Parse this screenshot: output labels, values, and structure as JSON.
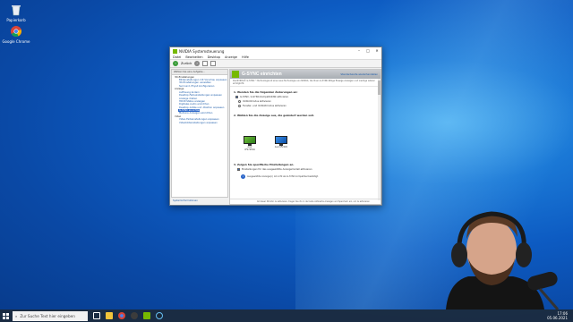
{
  "desktop": {
    "icons": [
      {
        "label": "Papierkorb",
        "icon": "recycle-bin-icon"
      },
      {
        "label": "Google Chrome",
        "icon": "chrome-icon"
      }
    ]
  },
  "window": {
    "title": "NVIDIA Systemsteuerung",
    "menu": [
      "Datei",
      "Bearbeiten",
      "Desktop",
      "Anzeige",
      "Hilfe"
    ],
    "toolbar": {
      "back_label": "Zurück",
      "icons": [
        "back-icon",
        "forward-icon",
        "home-icon",
        "settings-icon"
      ]
    },
    "left_panel": {
      "header": "Wählen Sie eine Aufgabe...",
      "tree": [
        {
          "type": "cat",
          "label": "3D-Einstellungen"
        },
        {
          "type": "item",
          "label": "Bildeinstellungen mit Vorschau anpassen"
        },
        {
          "type": "item",
          "label": "3D-Einstellungen verwalten"
        },
        {
          "type": "item",
          "label": "Surround, PhysX konfigurieren"
        },
        {
          "type": "cat",
          "label": "Anzeige"
        },
        {
          "type": "item",
          "label": "Auflösung ändern"
        },
        {
          "type": "item",
          "label": "Desktop-Farbeinstellungen anpassen"
        },
        {
          "type": "item",
          "label": "Anzeige drehen"
        },
        {
          "type": "item",
          "label": "HDCP-Status anzeigen"
        },
        {
          "type": "item",
          "label": "Digitales Audio einrichten"
        },
        {
          "type": "item",
          "label": "Desktop-Größe und -Position anpassen"
        },
        {
          "type": "item",
          "label": "G-SYNC einrichten",
          "selected": true
        },
        {
          "type": "item",
          "label": "Mehrere Anzeigen einrichten"
        },
        {
          "type": "cat",
          "label": "Video"
        },
        {
          "type": "item",
          "label": "Video-Farbeinstellungen anpassen"
        },
        {
          "type": "item",
          "label": "Videobildeinstellungen anpassen"
        }
      ],
      "status_link": "Systeminformationen"
    },
    "content": {
      "title": "G-SYNC einrichten",
      "restore": "Standardwerte wiederherstellen",
      "description": "Die NVIDIA® G-SYNC™-Technologie ist eine neue Technologie von NVIDIA, die Ihnen G-SYNC-fähige flüssige Anzeigen und niedrige Latenz ermöglicht.",
      "section1": "1. Wenden Sie die folgenden Änderungen an:",
      "enable_gsync": "G-SYNC, G-SYNC-Kompatibilität aktivieren",
      "radio_fullscreen": "Vollbildmodus aktivieren",
      "radio_windowed": "Fenster- und Vollbildmodus aktivieren",
      "section2": "2. Wählen Sie die Anzeige aus, die geändert werden soll.",
      "monitors": [
        {
          "label": "Acer XF270HUA",
          "selected": true
        },
        {
          "label": "Acer KF242Q"
        }
      ],
      "section3": "3. Zeigen Sie spezifische Einstellungen an.",
      "specific_settings": "Einstellungen für das ausgewählte Anzeigemodell aktivieren",
      "info_text": "Ausgewählte Anzeige(n) ist nicht als G-SYNC kompatibel bestätigt.",
      "footer": "Ist dieser Monitor zu aktivieren, tragen Sie ihn in der Liste Aktivierte Anzeigen und Speichern ein, um zu aktivieren"
    }
  },
  "taskbar": {
    "search_placeholder": "Zur Suche Text hier eingeben",
    "apps": [
      "task-view-icon",
      "file-explorer-icon",
      "chrome-icon",
      "obs-icon",
      "nvidia-icon",
      "steam-icon"
    ],
    "time": "17:06",
    "date": "05.06.2021"
  },
  "colors": {
    "nvidia_green": "#76b900",
    "selection_blue": "#2b66c9",
    "desktop_blue": "#0d5bc2"
  }
}
